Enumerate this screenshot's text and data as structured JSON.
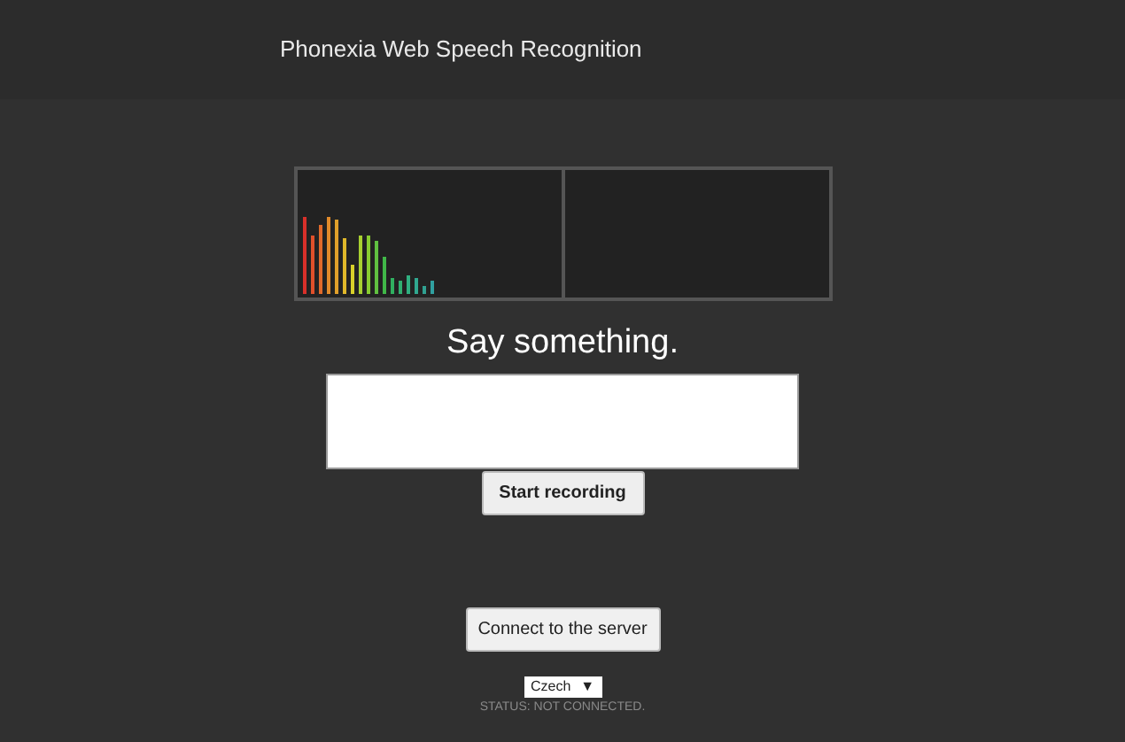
{
  "header": {
    "title": "Phonexia Web Speech Recognition"
  },
  "prompt": "Say something.",
  "buttons": {
    "record": "Start recording",
    "connect": "Connect to the server"
  },
  "language": {
    "value": "Czech",
    "arrow": "▼"
  },
  "status": "STATUS: NOT CONNECTED."
}
